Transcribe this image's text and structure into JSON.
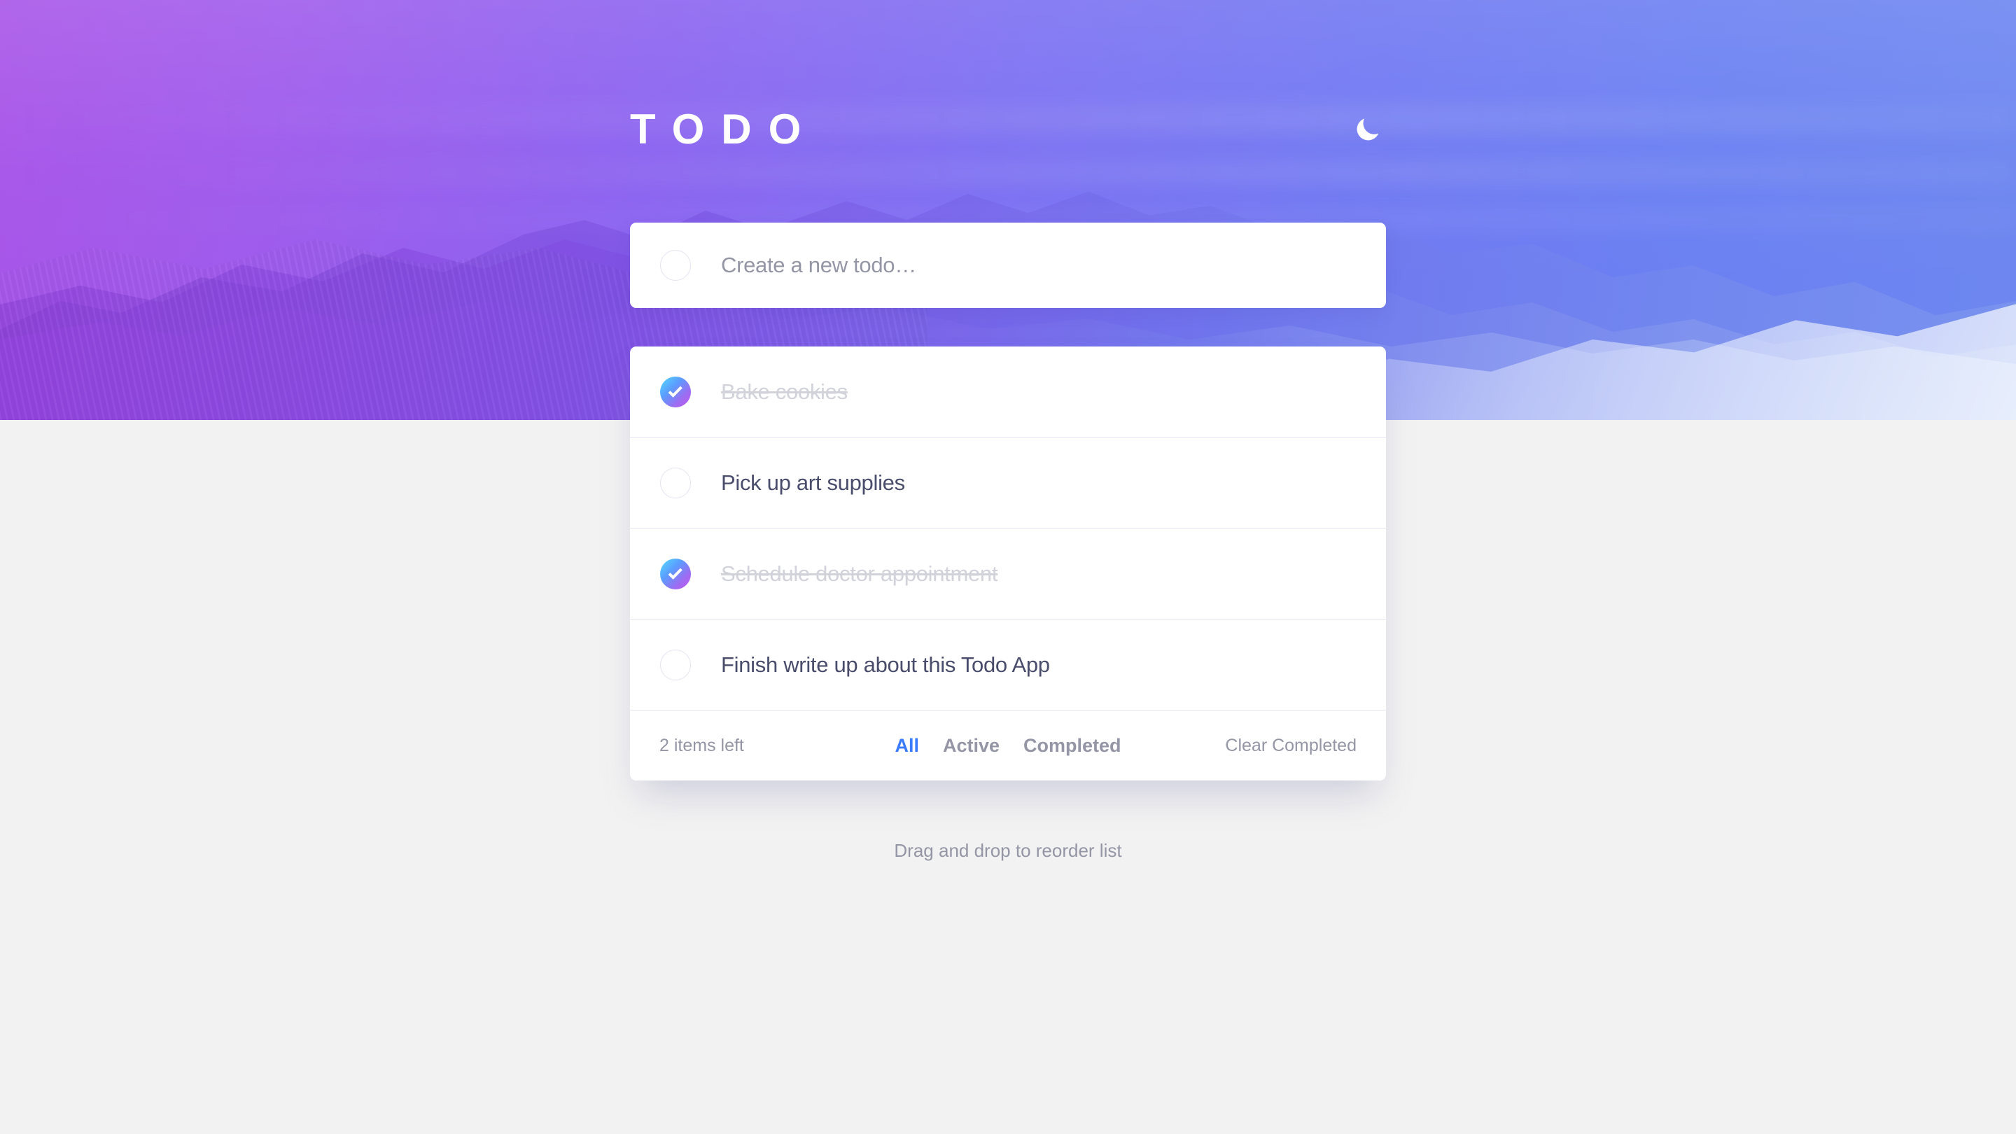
{
  "header": {
    "brand": "TODO",
    "theme_toggle_icon": "moon-icon"
  },
  "new_todo": {
    "placeholder": "Create a new todo…",
    "value": "",
    "checkbox_icon": "circle-outline-icon"
  },
  "todos": [
    {
      "label": "Bake cookies",
      "completed": true
    },
    {
      "label": "Pick up art supplies",
      "completed": false
    },
    {
      "label": "Schedule doctor appointment",
      "completed": true
    },
    {
      "label": "Finish write up about this Todo App",
      "completed": false
    }
  ],
  "footer": {
    "items_left": "2 items left",
    "filters": [
      {
        "label": "All",
        "active": true
      },
      {
        "label": "Active",
        "active": false
      },
      {
        "label": "Completed",
        "active": false
      }
    ],
    "clear_label": "Clear Completed"
  },
  "hint": "Drag and drop to reorder list",
  "colors": {
    "accent_blue": "#3A7CFD",
    "text_dark": "#494C6B",
    "text_muted": "#9495A5",
    "text_done": "#D1D2DA",
    "divider": "#E3E4F1",
    "page_bg": "#F2F2F2",
    "gradient_start": "#55DDFF",
    "gradient_end": "#C058F3",
    "hero_left": "#A855E8",
    "hero_right": "#6D87F0"
  }
}
